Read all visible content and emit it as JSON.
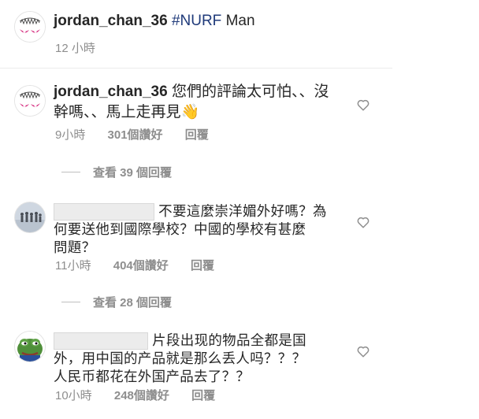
{
  "post": {
    "username": "jordan_chan_36",
    "hashtag": "#NURF",
    "caption_rest": "Man",
    "time": "12 小時"
  },
  "comments": [
    {
      "username": "jordan_chan_36",
      "text_line1": "您們的評論太可怕、、沒",
      "text_line2": "幹嗎、、馬上走再見👋",
      "time": "9小時",
      "likes": "301個讚好",
      "reply": "回覆",
      "view_replies": "查看 39 個回覆"
    },
    {
      "text_line1": "不要這麼崇洋媚外好嗎？為",
      "text_line2": "何要送他到國際學校？中國的學校有甚麼",
      "text_line3": "問題？",
      "time": "11小時",
      "likes": "404個讚好",
      "reply": "回覆",
      "view_replies": "查看 28 個回覆"
    },
    {
      "text_line1": "片段出现的物品全都是国",
      "text_line2": "外，用中国的产品就是那么丢人吗？？？",
      "text_line3": "人民币都花在外国产品去了？？",
      "time": "10小時",
      "likes": "248個讚好",
      "reply": "回覆"
    }
  ],
  "icons": {
    "heart": "heart-outline-icon",
    "accent": "#1f3a7a"
  }
}
